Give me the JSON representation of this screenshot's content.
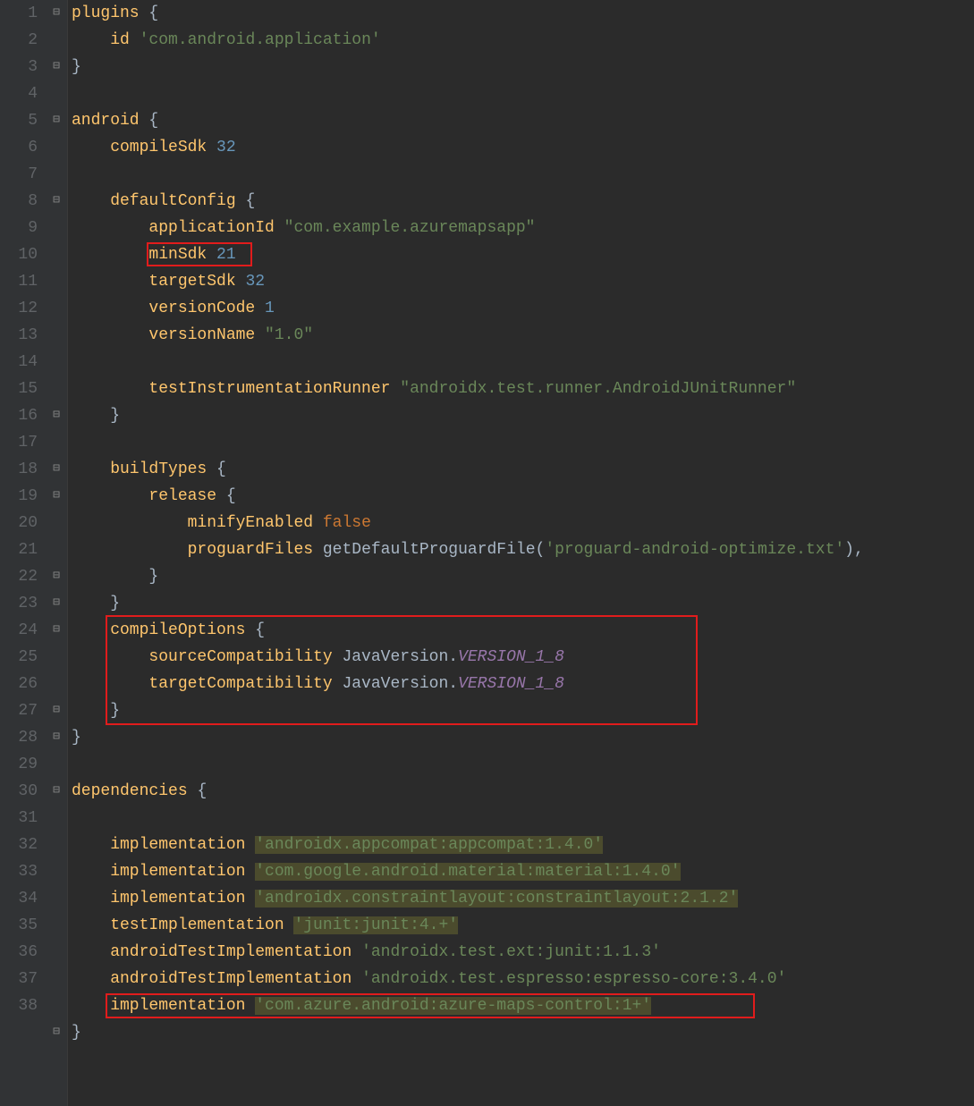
{
  "gutter": {
    "1": "1",
    "2": "2",
    "3": "3",
    "4": "4",
    "5": "5",
    "6": "6",
    "7": "7",
    "8": "8",
    "9": "9",
    "10": "10",
    "11": "11",
    "12": "12",
    "13": "13",
    "14": "14",
    "15": "15",
    "16": "16",
    "17": "17",
    "18": "18",
    "19": "19",
    "20": "20",
    "21": "21",
    "22": "22",
    "23": "23",
    "24": "24",
    "25": "25",
    "26": "26",
    "27": "27",
    "28": "28",
    "29": "29",
    "30": "30",
    "31": "31",
    "32": "32",
    "33": "33",
    "34": "34",
    "35": "35",
    "36": "36",
    "37": "37",
    "38": "38"
  },
  "c": {
    "l1a": "plugins ",
    "l1b": "{",
    "l2a": "    id ",
    "l2b": "'com.android.application'",
    "l3a": "}",
    "l5a": "android ",
    "l5b": "{",
    "l6a": "    compileSdk ",
    "l6b": "32",
    "l8a": "    defaultConfig ",
    "l8b": "{",
    "l9a": "        applicationId ",
    "l9b": "\"com.example.azuremapsapp\"",
    "l10a": "        minSdk ",
    "l10b": "21",
    "l11a": "        targetSdk ",
    "l11b": "32",
    "l12a": "        versionCode ",
    "l12b": "1",
    "l13a": "        versionName ",
    "l13b": "\"1.0\"",
    "l15a": "        testInstrumentationRunner ",
    "l15b": "\"androidx.test.runner.AndroidJUnitRunner\"",
    "l16a": "    }",
    "l18a": "    buildTypes ",
    "l18b": "{",
    "l19a": "        release ",
    "l19b": "{",
    "l20a": "            minifyEnabled ",
    "l20b": "false",
    "l21a": "            proguardFiles ",
    "l21b": "getDefaultProguardFile(",
    "l21c": "'proguard-android-optimize.txt'",
    "l21d": "),",
    "l22a": "        }",
    "l23a": "    }",
    "l24a": "    compileOptions ",
    "l24b": "{",
    "l25a": "        sourceCompatibility ",
    "l25b": "JavaVersion.",
    "l25c": "VERSION_1_8",
    "l26a": "        targetCompatibility ",
    "l26b": "JavaVersion.",
    "l26c": "VERSION_1_8",
    "l27a": "    }",
    "l28a": "}",
    "l30a": "dependencies ",
    "l30b": "{",
    "l32a": "    implementation ",
    "l32b": "'androidx.appcompat:appcompat:1.4.0'",
    "l33a": "    implementation ",
    "l33b": "'com.google.android.material:material:1.4.0'",
    "l34a": "    implementation ",
    "l34b": "'androidx.constraintlayout:constraintlayout:2.1.2'",
    "l35a": "    testImplementation ",
    "l35b": "'junit:junit:4.+'",
    "l36a": "    androidTestImplementation ",
    "l36b": "'androidx.test.ext:junit:1.1.3'",
    "l37a": "    androidTestImplementation ",
    "l37b": "'androidx.test.espresso:espresso-core:3.4.0'",
    "l38a": "    implementation ",
    "l38b": "'com.azure.android:azure-maps-control:1+'",
    "l39a": "}"
  }
}
